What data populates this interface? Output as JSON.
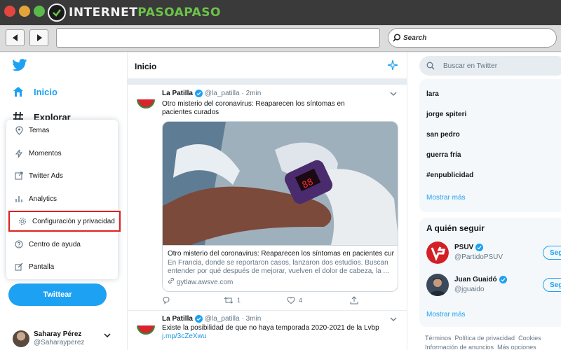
{
  "browser": {
    "brand_prefix": "INTERNET",
    "brand_accent": "PASOAPASO",
    "search_label": "Search"
  },
  "sidebar": {
    "home_label": "Inicio",
    "explore_label": "Explorar",
    "menu": [
      {
        "label": "Temas",
        "icon": "location-pin-icon"
      },
      {
        "label": "Momentos",
        "icon": "lightning-icon"
      },
      {
        "label": "Twitter Ads",
        "icon": "external-link-icon"
      },
      {
        "label": "Analytics",
        "icon": "bar-chart-icon"
      },
      {
        "label": "Configuración y privacidad",
        "icon": "gear-icon",
        "highlighted": true
      },
      {
        "label": "Centro de ayuda",
        "icon": "question-icon"
      },
      {
        "label": "Pantalla",
        "icon": "edit-display-icon"
      }
    ],
    "tweet_button": "Twittear",
    "profile": {
      "name": "Saharay Pérez",
      "handle": "@Saharayperez"
    }
  },
  "timeline": {
    "title": "Inicio",
    "tweets": [
      {
        "author": "La Patilla",
        "handle": "@la_patilla",
        "time": "· 2min",
        "text": "Otro misterio del coronavirus: Reaparecen los síntomas  en  pacientes curados",
        "card": {
          "title": "Otro misterio del coronavirus: Reaparecen los síntomas en pacientes cur...",
          "description": "En Francia, donde se reportaron casos, lanzaron dos estudios. Buscan entender por qué después de mejorar, vuelven el dolor de cabeza, la ...",
          "url": "gytlaw.awsve.com"
        },
        "actions": {
          "replies": "",
          "retweets": "1",
          "likes": "4"
        }
      },
      {
        "author": "La Patilla",
        "handle": "@la_patilla",
        "time": "· 3min",
        "text": "Existe la posibilidad de que no haya temporada 2020-2021 de la Lvbp",
        "link": "j.mp/3cZeXwu"
      }
    ]
  },
  "right_column": {
    "search_placeholder": "Buscar en Twitter",
    "trends": [
      "lara",
      "jorge spiteri",
      "san pedro",
      "guerra fría",
      "#enpublicidad"
    ],
    "trends_more": "Mostrar más",
    "who_to_follow": {
      "title": "A quién seguir",
      "accounts": [
        {
          "name": "PSUV",
          "handle": "@PartidoPSUV",
          "button": "Segu"
        },
        {
          "name": "Juan Guaidó",
          "handle": "@jguaido",
          "button": "Segu"
        }
      ],
      "more": "Mostrar más"
    },
    "footer": [
      "Términos",
      "Política de privacidad",
      "Cookies",
      "Información de anuncios",
      "Más opciones"
    ]
  },
  "colors": {
    "twitter_blue": "#1da1f2",
    "highlight_red": "#e0201e",
    "brand_green": "#6cc24a"
  }
}
